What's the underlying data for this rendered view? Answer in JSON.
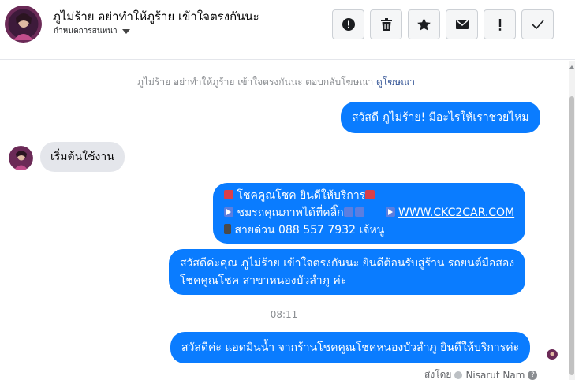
{
  "header": {
    "title": "ภูไม่ร้าย อย่าทำให้ภูร้าย เข้าใจตรงกันนะ",
    "subtitle": "กำหนดการสนทนา",
    "actions": [
      {
        "name": "report",
        "icon": "alert-circle-icon"
      },
      {
        "name": "delete",
        "icon": "trash-icon"
      },
      {
        "name": "star",
        "icon": "star-icon"
      },
      {
        "name": "mark-unread",
        "icon": "envelope-icon"
      },
      {
        "name": "spam",
        "icon": "exclamation-icon"
      },
      {
        "name": "done",
        "icon": "check-icon"
      }
    ]
  },
  "thread": {
    "ad_note": "ภูไม่ร้าย อย่าทำให้ภูร้าย เข้าใจตรงกันนะ ตอบกลับโฆษณา",
    "ad_link": "ดูโฆษณา",
    "messages": {
      "m1": "สวัสดี ภูไม่ร้าย! มีอะไรให้เราช่วยไหม",
      "m2": "เริ่มต้นใช้งาน",
      "m3_line1": "โชคคูณโชค ยินดีให้บริการ",
      "m3_line2": "ชมรถคุณภาพได้ที่คลิ๊ก",
      "m3_link": "WWW.CKC2CAR.COM",
      "m3_line3": "สายด่วน 088 557 7932 เจ้หนู",
      "m4_line1": "สวัสดีค่ะคุณ ภูไม่ร้าย เข้าใจตรงกันนะ ยินดีต้อนรับสู่ร้าน รถยนต์มือสอง",
      "m4_line2": "โชคคูณโชค สาขาหนองบัวลำภู ค่ะ",
      "m5": "สวัสดีค่ะ แอดมินน้ำ จากร้านโชคคูณโชคหนองบัวลำภู ยินดีให้บริการค่ะ"
    },
    "timestamp": "08:11",
    "sent_by_label": "ส่งโดย",
    "sent_by_name": "Nisarut Nam"
  },
  "colors": {
    "outgoing_bubble": "#0a7cff",
    "incoming_bubble": "#e4e6eb",
    "link": "#385898"
  }
}
